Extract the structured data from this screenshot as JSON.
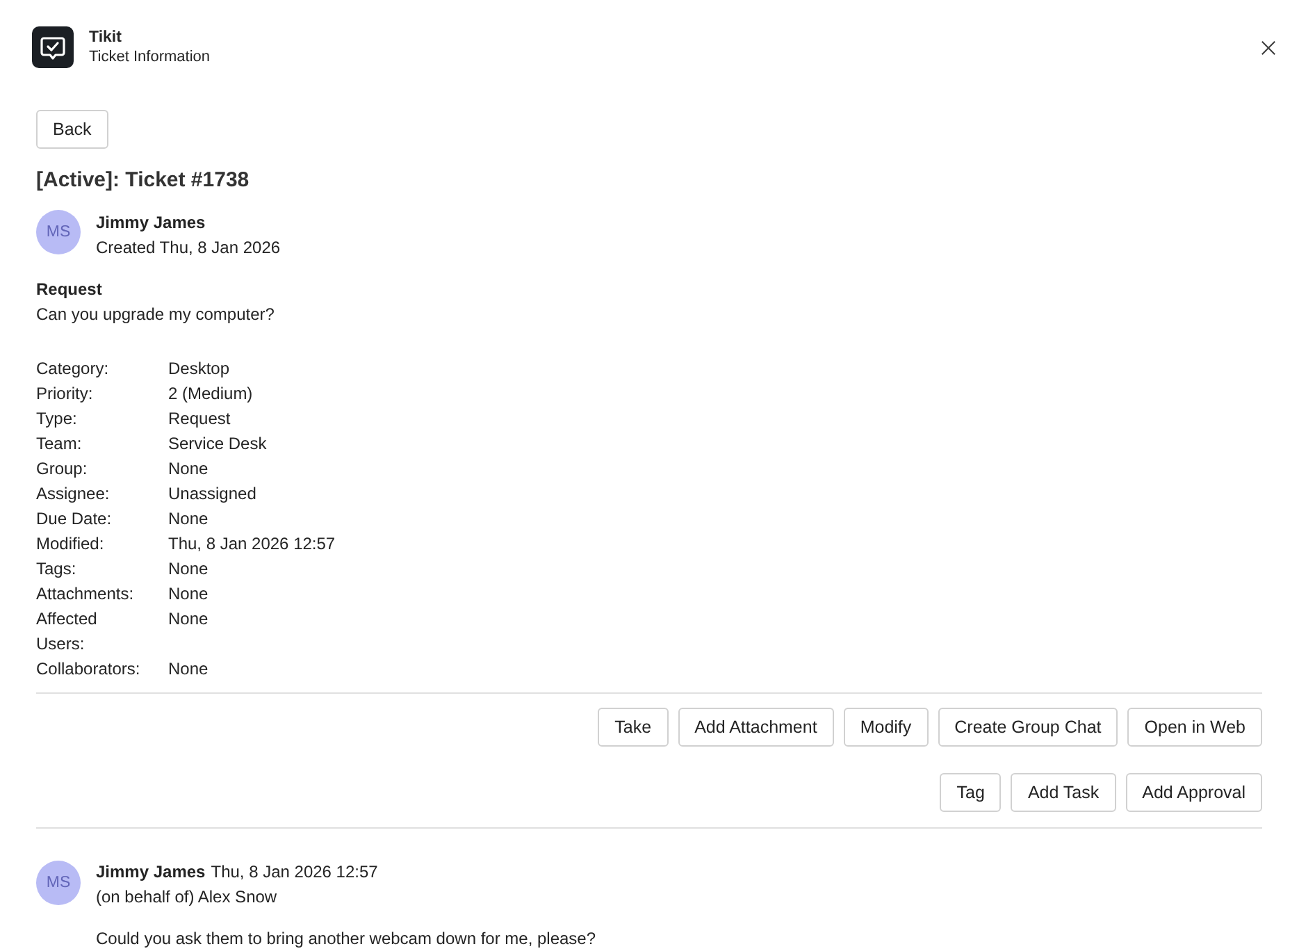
{
  "header": {
    "app_name": "Tikit",
    "subtitle": "Ticket Information"
  },
  "back_button": "Back",
  "ticket": {
    "title": "[Active]: Ticket #1738",
    "author": {
      "initials": "MS",
      "name": "Jimmy James",
      "created": "Created Thu, 8 Jan 2026"
    },
    "request": {
      "label": "Request",
      "text": "Can you upgrade my computer?"
    },
    "fields": [
      {
        "label": "Category:",
        "value": "Desktop"
      },
      {
        "label": "Priority:",
        "value": "2 (Medium)"
      },
      {
        "label": "Type:",
        "value": "Request"
      },
      {
        "label": "Team:",
        "value": "Service Desk"
      },
      {
        "label": "Group:",
        "value": "None"
      },
      {
        "label": "Assignee:",
        "value": "Unassigned"
      },
      {
        "label": "Due Date:",
        "value": "None"
      },
      {
        "label": "Modified:",
        "value": "Thu, 8 Jan 2026 12:57"
      },
      {
        "label": "Tags:",
        "value": "None"
      },
      {
        "label": "Attachments:",
        "value": "None"
      },
      {
        "label": "Affected Users:",
        "value": "None"
      },
      {
        "label": "Collaborators:",
        "value": "None"
      }
    ]
  },
  "action_rows": [
    {
      "buttons": [
        "Take",
        "Add Attachment",
        "Modify",
        "Create Group Chat",
        "Open in Web"
      ]
    },
    {
      "buttons": [
        "Tag",
        "Add Task",
        "Add Approval"
      ]
    }
  ],
  "comments": [
    {
      "initials": "MS",
      "author": "Jimmy James",
      "time": "Thu, 8 Jan 2026 12:57",
      "on_behalf": "(on behalf of) Alex Snow",
      "text": "Could you ask them to bring another webcam down for me, please?"
    }
  ]
}
